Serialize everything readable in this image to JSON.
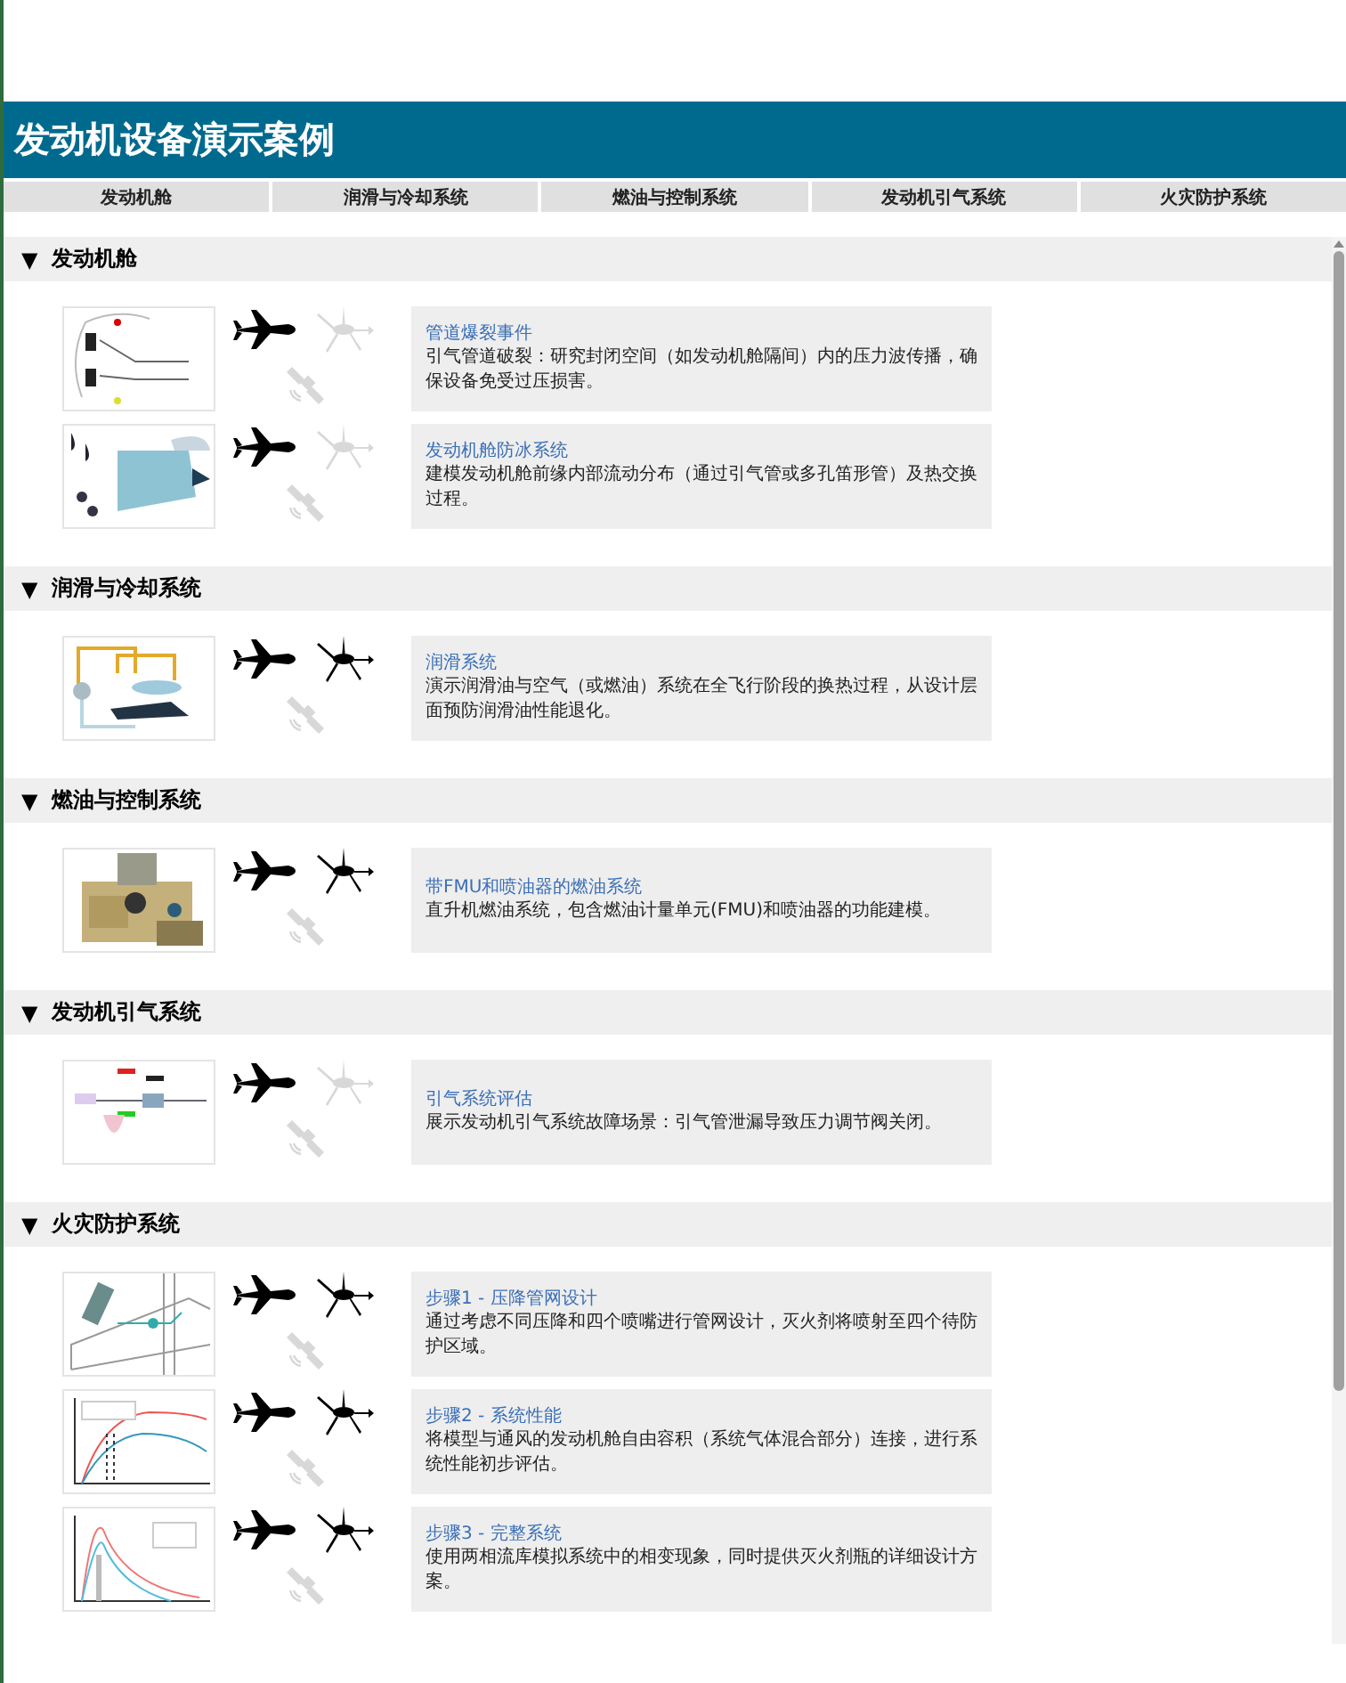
{
  "header": {
    "title": "发动机设备演示案例"
  },
  "tabs": [
    {
      "label": "发动机舱",
      "selected": false
    },
    {
      "label": "润滑与冷却系统",
      "selected": false
    },
    {
      "label": "燃油与控制系统",
      "selected": false
    },
    {
      "label": "发动机引气系统",
      "selected": false
    },
    {
      "label": "火灾防护系统",
      "selected": false
    }
  ],
  "sections": [
    {
      "marker": "▼",
      "title": "发动机舱",
      "cases": [
        {
          "platforms": [
            {
              "kind": "airplane",
              "on": true
            },
            {
              "kind": "drone",
              "on": false
            },
            {
              "kind": "satellite",
              "on": false
            }
          ],
          "title": "管道爆裂事件",
          "description": "引气管道破裂：研究封闭空间（如发动机舱隔间）内的压力波传播，确保设备免受过压损害。"
        },
        {
          "platforms": [
            {
              "kind": "airplane",
              "on": true
            },
            {
              "kind": "drone",
              "on": false
            },
            {
              "kind": "satellite",
              "on": false
            }
          ],
          "title": "发动机舱防冰系统",
          "description": "建模发动机舱前缘内部流动分布（通过引气管或多孔笛形管）及热交换过程。"
        }
      ]
    },
    {
      "marker": "▼",
      "title": "润滑与冷却系统",
      "cases": [
        {
          "platforms": [
            {
              "kind": "airplane",
              "on": true
            },
            {
              "kind": "drone",
              "on": true
            },
            {
              "kind": "satellite",
              "on": false
            }
          ],
          "title": "润滑系统",
          "description": "演示润滑油与空气（或燃油）系统在全飞行阶段的换热过程，从设计层面预防润滑油性能退化。"
        }
      ]
    },
    {
      "marker": "▼",
      "title": "燃油与控制系统",
      "cases": [
        {
          "platforms": [
            {
              "kind": "airplane",
              "on": true
            },
            {
              "kind": "drone",
              "on": true
            },
            {
              "kind": "satellite",
              "on": false
            }
          ],
          "title": "带FMU和喷油器的燃油系统",
          "description": "直升机燃油系统，包含燃油计量单元(FMU)和喷油器的功能建模。"
        }
      ]
    },
    {
      "marker": "▼",
      "title": "发动机引气系统",
      "cases": [
        {
          "platforms": [
            {
              "kind": "airplane",
              "on": true
            },
            {
              "kind": "drone",
              "on": false
            },
            {
              "kind": "satellite",
              "on": false
            }
          ],
          "title": "引气系统评估",
          "description": "展示发动机引气系统故障场景：引气管泄漏导致压力调节阀关闭。"
        }
      ]
    },
    {
      "marker": "▼",
      "title": "火灾防护系统",
      "cases": [
        {
          "platforms": [
            {
              "kind": "airplane",
              "on": true
            },
            {
              "kind": "drone",
              "on": true
            },
            {
              "kind": "satellite",
              "on": false
            }
          ],
          "title": "步骤1 - 压降管网设计",
          "description": "通过考虑不同压降和四个喷嘴进行管网设计，灭火剂将喷射至四个待防护区域。"
        },
        {
          "platforms": [
            {
              "kind": "airplane",
              "on": true
            },
            {
              "kind": "drone",
              "on": true
            },
            {
              "kind": "satellite",
              "on": false
            }
          ],
          "title": "步骤2 - 系统性能",
          "description": "将模型与通风的发动机舱自由容积（系统气体混合部分）连接，进行系统性能初步评估。"
        },
        {
          "platforms": [
            {
              "kind": "airplane",
              "on": true
            },
            {
              "kind": "drone",
              "on": true
            },
            {
              "kind": "satellite",
              "on": false
            }
          ],
          "title": "步骤3 - 完整系统",
          "description": "使用两相流库模拟系统中的相变现象，同时提供灭火剂瓶的详细设计方案。"
        }
      ]
    }
  ]
}
